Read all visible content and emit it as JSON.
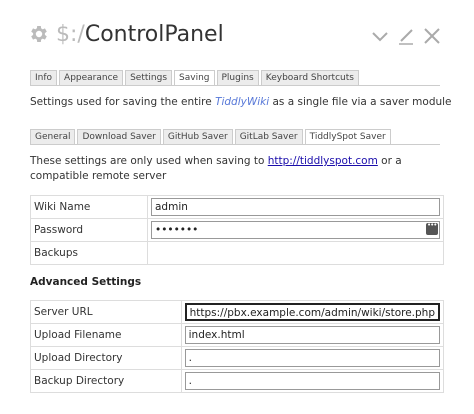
{
  "header": {
    "title_prefix": "$:/",
    "title_main": "ControlPanel",
    "icons": [
      "gear-icon",
      "chevron-down-icon",
      "edit-icon",
      "close-icon"
    ]
  },
  "tabs": [
    "Info",
    "Appearance",
    "Settings",
    "Saving",
    "Plugins",
    "Keyboard Shortcuts"
  ],
  "active_tab": "Saving",
  "saving": {
    "desc_before": "Settings used for saving the entire ",
    "desc_wiki": "TiddlyWiki",
    "desc_after": " as a single file via a saver module"
  },
  "subtabs": [
    "General",
    "Download Saver",
    "GitHub Saver",
    "GitLab Saver",
    "TiddlySpot Saver"
  ],
  "active_subtab": "TiddlySpot Saver",
  "tiddlyspot": {
    "desc_before": "These settings are only used when saving to ",
    "link": "http://tiddlyspot.com",
    "desc_after": " or a compatible remote server",
    "wiki_name_label": "Wiki Name",
    "wiki_name_value": "admin",
    "password_label": "Password",
    "password_mask": "•••••••",
    "backups_label": "Backups",
    "advanced_heading": "Advanced Settings",
    "server_url_label": "Server URL",
    "server_url_value": "https://pbx.example.com/admin/wiki/store.php",
    "upload_filename_label": "Upload Filename",
    "upload_filename_value": "index.html",
    "upload_directory_label": "Upload Directory",
    "upload_directory_value": ".",
    "backup_directory_label": "Backup Directory",
    "backup_directory_value": "."
  },
  "colors": {
    "link": "#1a0dab",
    "wiki_link": "#5778d8",
    "tab_bg": "#ececec",
    "border": "#dddddd"
  }
}
